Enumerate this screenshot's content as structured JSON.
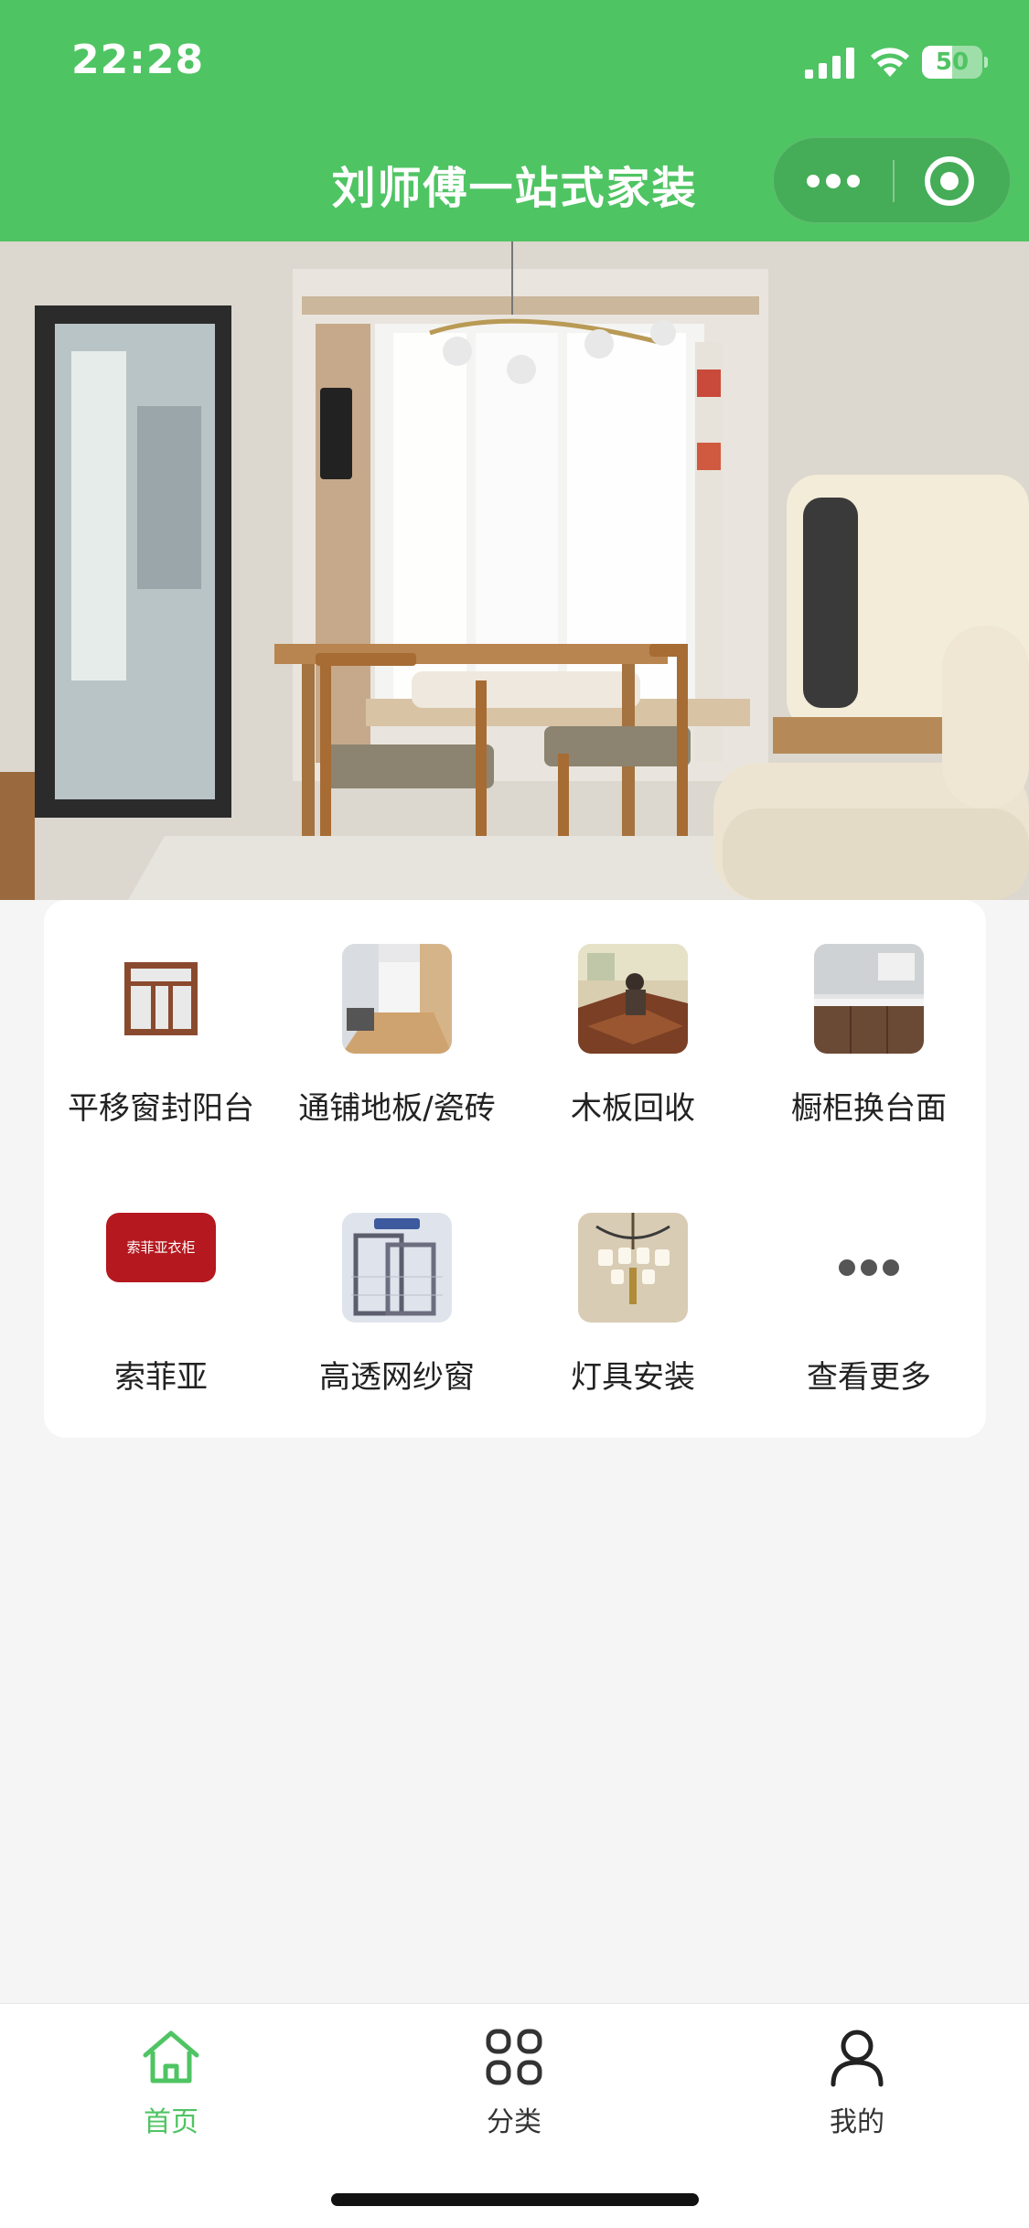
{
  "status_bar": {
    "time": "22:28",
    "battery_level": "50",
    "battery_fraction": 0.5,
    "icons": [
      "signal-icon",
      "wifi-icon",
      "battery-icon"
    ]
  },
  "nav": {
    "title": "刘师傅一站式家装",
    "capsule_icons": [
      "more-icon",
      "close-miniprogram-icon"
    ]
  },
  "banner": {
    "slide_count": 5,
    "active_index": 4
  },
  "grid": {
    "items": [
      {
        "label": "平移窗封阳台",
        "icon": "sliding-window-thumb"
      },
      {
        "label": "通铺地板/瓷砖",
        "icon": "floor-tile-thumb"
      },
      {
        "label": "木板回收",
        "icon": "wood-recycle-thumb"
      },
      {
        "label": "橱柜换台面",
        "icon": "kitchen-counter-thumb"
      },
      {
        "label": "索菲亚",
        "icon": "sofia-brand-thumb"
      },
      {
        "label": "高透网纱窗",
        "icon": "screen-window-thumb"
      },
      {
        "label": "灯具安装",
        "icon": "lamp-install-thumb"
      },
      {
        "label": "查看更多",
        "icon": "more-dots-icon"
      }
    ],
    "brand_logo_text": "索菲亚衣柜"
  },
  "tabbar": {
    "tabs": [
      {
        "label": "首页",
        "icon": "home-icon",
        "active": true
      },
      {
        "label": "分类",
        "icon": "category-icon",
        "active": false
      },
      {
        "label": "我的",
        "icon": "profile-icon",
        "active": false
      }
    ]
  },
  "colors": {
    "brand_green": "#4fc463",
    "active_tab": "#4fc463",
    "inactive_tab": "#333333",
    "background": "#f5f5f5"
  }
}
